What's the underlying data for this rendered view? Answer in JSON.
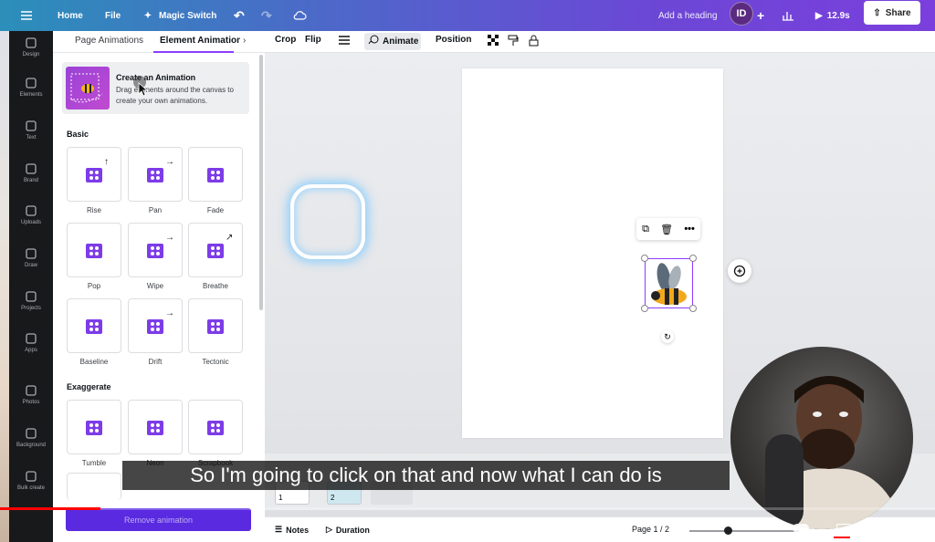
{
  "topbar": {
    "home": "Home",
    "file": "File",
    "magic_switch": "Magic Switch",
    "add_heading": "Add a heading",
    "avatar": "ID",
    "timer": "12.9s",
    "share": "Share"
  },
  "rail": {
    "items": [
      {
        "label": "Design",
        "icon": "design-icon"
      },
      {
        "label": "Elements",
        "icon": "elements-icon"
      },
      {
        "label": "Text",
        "icon": "text-icon"
      },
      {
        "label": "Brand",
        "icon": "brand-icon"
      },
      {
        "label": "Uploads",
        "icon": "uploads-icon"
      },
      {
        "label": "Draw",
        "icon": "draw-icon"
      },
      {
        "label": "Projects",
        "icon": "projects-icon"
      },
      {
        "label": "Apps",
        "icon": "apps-icon"
      },
      {
        "label": "Photos",
        "icon": "photos-icon"
      },
      {
        "label": "Background",
        "icon": "background-icon"
      },
      {
        "label": "Bulk create",
        "icon": "bulk-create-icon"
      }
    ]
  },
  "panel": {
    "tabs": [
      "Page Animations",
      "Element Animations"
    ],
    "create": {
      "title": "Create an Animation",
      "desc": "Drag elements around the canvas to create your own animations."
    },
    "sections": {
      "basic": "Basic",
      "exaggerate": "Exaggerate"
    },
    "basic": [
      "Rise",
      "Pan",
      "Fade",
      "Pop",
      "Wipe",
      "Breathe",
      "Baseline",
      "Drift",
      "Tectonic"
    ],
    "exaggerate": [
      "Tumble",
      "Neon",
      "Scrapbook"
    ],
    "remove": "Remove animation"
  },
  "toolbar": {
    "crop": "Crop",
    "flip": "Flip",
    "animate": "Animate",
    "position": "Position"
  },
  "bottombar": {
    "notes": "Notes",
    "duration": "Duration",
    "page": "Page 1 / 2"
  },
  "thumbs": [
    "1",
    "2"
  ],
  "video": {
    "caption": "So I'm going to click on that and now what I can do is",
    "progress": 0.107
  },
  "colors": {
    "accent": "#8b3dff",
    "remove_button": "#5a2ae0"
  }
}
